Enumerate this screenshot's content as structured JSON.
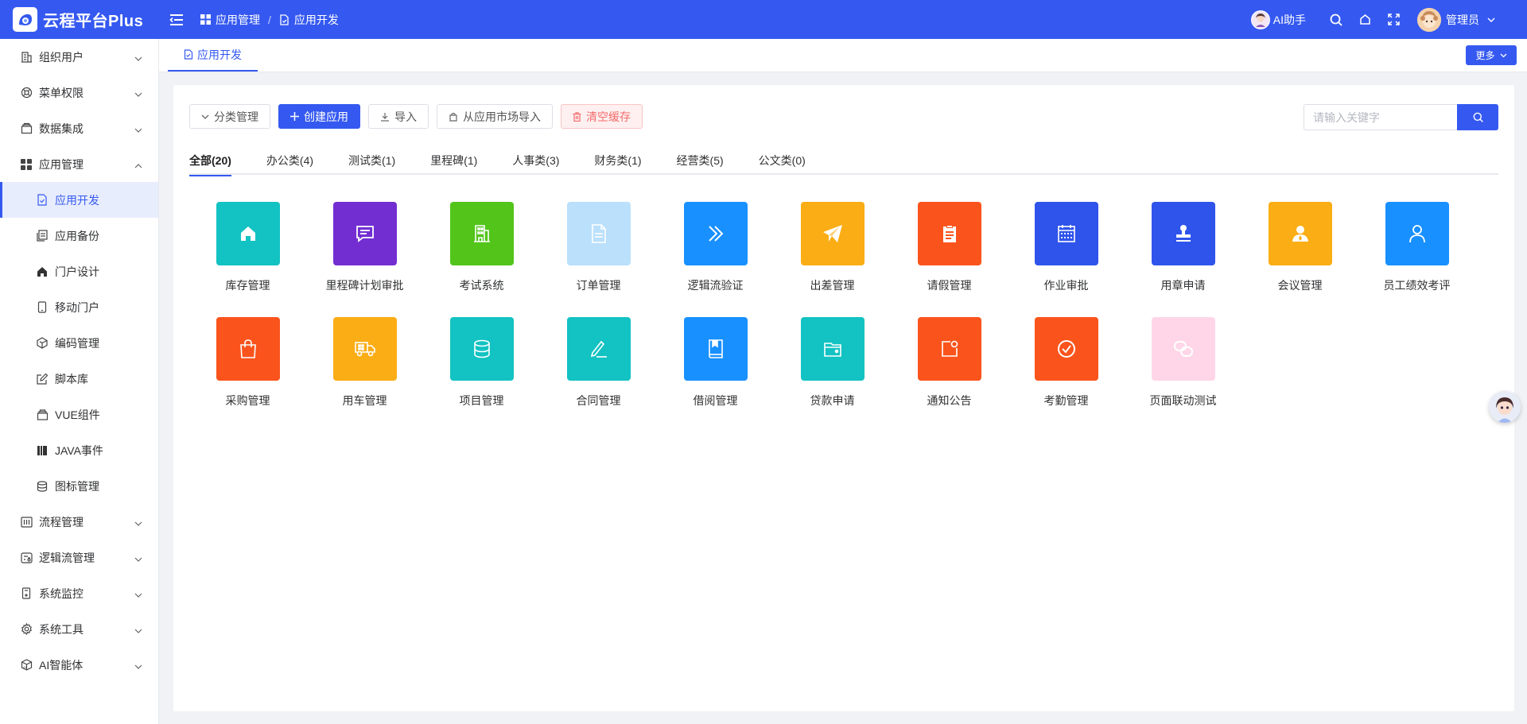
{
  "header": {
    "logo_text": "云程平台Plus",
    "breadcrumb": [
      "应用管理",
      "应用开发"
    ],
    "ai_helper": "AI助手",
    "user_name": "管理员"
  },
  "sidebar": {
    "items": [
      {
        "label": "组织用户",
        "icon": "building-icon",
        "expanded": false
      },
      {
        "label": "菜单权限",
        "icon": "lifebuoy-icon",
        "expanded": false
      },
      {
        "label": "数据集成",
        "icon": "stack-icon",
        "expanded": false
      },
      {
        "label": "应用管理",
        "icon": "grid-icon",
        "expanded": true
      },
      {
        "label": "应用开发",
        "icon": "file-icon",
        "sub": true,
        "active": true
      },
      {
        "label": "应用备份",
        "icon": "copy-icon",
        "sub": true
      },
      {
        "label": "门户设计",
        "icon": "home-icon",
        "sub": true
      },
      {
        "label": "移动门户",
        "icon": "mobile-icon",
        "sub": true
      },
      {
        "label": "编码管理",
        "icon": "cube-icon",
        "sub": true
      },
      {
        "label": "脚本库",
        "icon": "edit-icon",
        "sub": true
      },
      {
        "label": "VUE组件",
        "icon": "layers-icon",
        "sub": true
      },
      {
        "label": "JAVA事件",
        "icon": "book-icon",
        "sub": true
      },
      {
        "label": "图标管理",
        "icon": "database-icon",
        "sub": true
      },
      {
        "label": "流程管理",
        "icon": "flow-icon",
        "expanded": false
      },
      {
        "label": "逻辑流管理",
        "icon": "logic-icon",
        "expanded": false
      },
      {
        "label": "系统监控",
        "icon": "monitor-icon",
        "expanded": false
      },
      {
        "label": "系统工具",
        "icon": "gear-icon",
        "expanded": false
      },
      {
        "label": "AI智能体",
        "icon": "ai-box-icon",
        "expanded": false
      }
    ]
  },
  "tabbar": {
    "active_tab": "应用开发",
    "more_label": "更多"
  },
  "toolbar": {
    "category_label": "分类管理",
    "create_label": "创建应用",
    "import_label": "导入",
    "market_import_label": "从应用市场导入",
    "clear_cache_label": "清空缓存",
    "search_placeholder": "请输入关键字"
  },
  "categories": [
    "全部(20)",
    "办公类(4)",
    "测试类(1)",
    "里程碑(1)",
    "人事类(3)",
    "财务类(1)",
    "经营类(5)",
    "公文类(0)"
  ],
  "apps": [
    {
      "name": "库存管理",
      "color": "#13c2c2",
      "icon": "home-icon"
    },
    {
      "name": "里程碑计划审批",
      "color": "#722ed1",
      "icon": "message-icon"
    },
    {
      "name": "考试系统",
      "color": "#52c41a",
      "icon": "office-icon"
    },
    {
      "name": "订单管理",
      "color": "#bae0fc",
      "icon": "document-icon"
    },
    {
      "name": "逻辑流验证",
      "color": "#1890ff",
      "icon": "double-chevron-icon"
    },
    {
      "name": "出差管理",
      "color": "#faad14",
      "icon": "paper-plane-icon"
    },
    {
      "name": "请假管理",
      "color": "#fa541c",
      "icon": "clipboard-icon"
    },
    {
      "name": "作业审批",
      "color": "#2f54eb",
      "icon": "calendar-icon"
    },
    {
      "name": "用章申请",
      "color": "#2f54eb",
      "icon": "stamp-icon"
    },
    {
      "name": "会议管理",
      "color": "#faad14",
      "icon": "person-icon"
    },
    {
      "name": "员工绩效考评",
      "color": "#1890ff",
      "icon": "user-outline-icon"
    },
    {
      "name": "采购管理",
      "color": "#fa541c",
      "icon": "shopping-bag-icon"
    },
    {
      "name": "用车管理",
      "color": "#faad14",
      "icon": "truck-icon"
    },
    {
      "name": "项目管理",
      "color": "#13c2c2",
      "icon": "database-icon"
    },
    {
      "name": "合同管理",
      "color": "#13c2c2",
      "icon": "pen-icon"
    },
    {
      "name": "借阅管理",
      "color": "#1890ff",
      "icon": "bookmark-book-icon"
    },
    {
      "name": "贷款申请",
      "color": "#13c2c2",
      "icon": "wallet-icon"
    },
    {
      "name": "通知公告",
      "color": "#fa541c",
      "icon": "notification-icon"
    },
    {
      "name": "考勤管理",
      "color": "#fa541c",
      "icon": "check-circle-icon"
    },
    {
      "name": "页面联动测试",
      "color": "#ffd6e7",
      "icon": "link-icon"
    }
  ]
}
